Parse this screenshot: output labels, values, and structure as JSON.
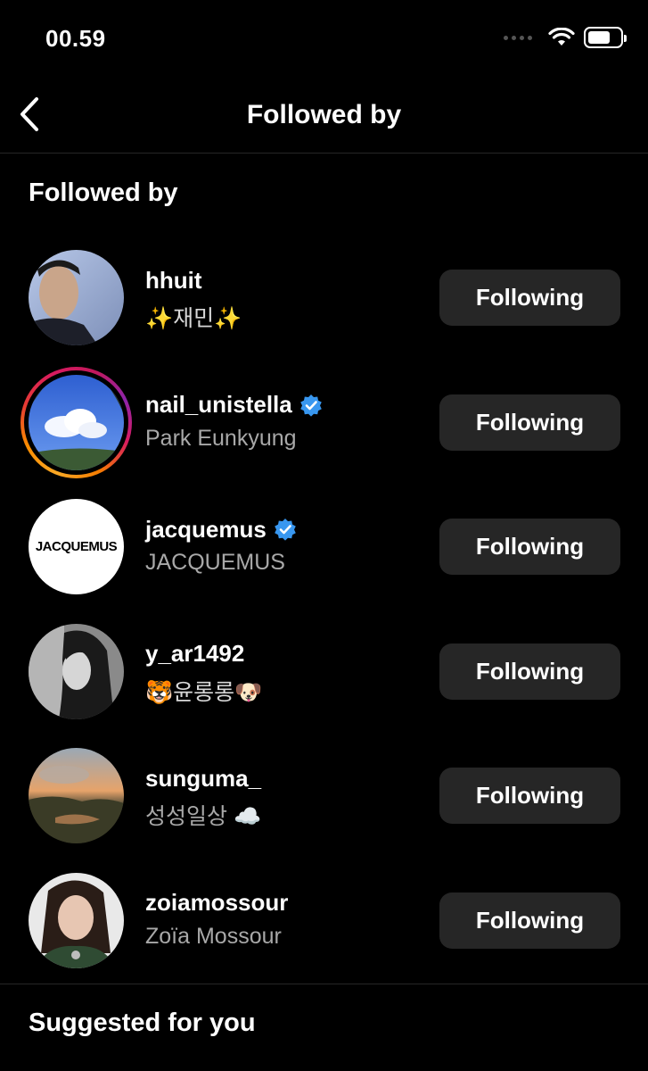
{
  "status": {
    "time": "00.59"
  },
  "nav": {
    "title": "Followed by"
  },
  "section_followed": "Followed by",
  "section_suggested": "Suggested for you",
  "users": [
    {
      "username": "hhuit",
      "fullname": "✨재민✨",
      "verified": false,
      "story": false,
      "button": "Following"
    },
    {
      "username": "nail_unistella",
      "fullname": "Park Eunkyung",
      "verified": true,
      "story": true,
      "button": "Following"
    },
    {
      "username": "jacquemus",
      "fullname": "JACQUEMUS",
      "verified": true,
      "story": false,
      "button": "Following",
      "logo_text": "JACQUEMUS"
    },
    {
      "username": "y_ar1492",
      "fullname": "🐯윤롱롱🐶",
      "verified": false,
      "story": false,
      "button": "Following"
    },
    {
      "username": "sunguma_",
      "fullname": "성성일상 ☁️",
      "verified": false,
      "story": false,
      "button": "Following"
    },
    {
      "username": "zoiamossour",
      "fullname": "Zoïa Mossour",
      "verified": false,
      "story": false,
      "button": "Following"
    }
  ],
  "colors": {
    "background": "#000000",
    "button": "#262626",
    "secondary_text": "#a8a8a8",
    "verified": "#3897f0"
  }
}
